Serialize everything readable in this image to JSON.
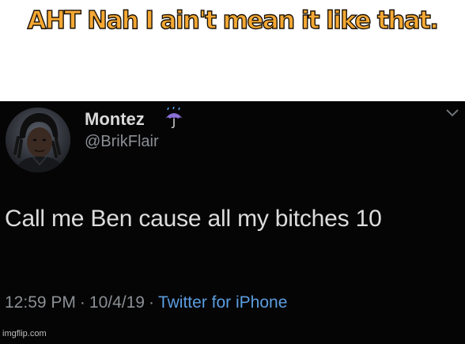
{
  "caption": {
    "text": "AHT Nah I ain't mean it like that."
  },
  "tweet": {
    "name": "Montez",
    "handle": "@BrikFlair",
    "name_icon": "umbrella-rain-icon",
    "menu_icon": "chevron-down-icon",
    "text": "Call me Ben cause all my bitches 10",
    "time": "12:59 PM",
    "date": "10/4/19",
    "source": "Twitter for iPhone",
    "separator": "·",
    "colors": {
      "background": "#050505",
      "link": "#5b9de0",
      "muted": "#8b8f94",
      "text": "#dcdcdc",
      "caption_fill": "#f5a833"
    }
  },
  "watermark": {
    "text": "imgflip.com"
  }
}
